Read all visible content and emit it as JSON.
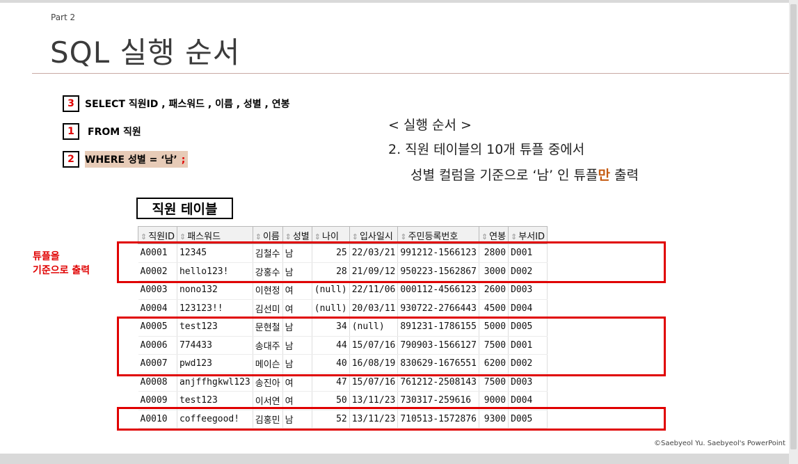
{
  "slide": {
    "part": "Part 2",
    "title": "SQL 실행 순서",
    "copyright": "©Saebyeol Yu. Saebyeol's PowerPoint"
  },
  "query": {
    "select": {
      "num": "3",
      "text": "SELECT 직원ID ,  패스워드 , 이름 , 성별 , 연봉"
    },
    "from": {
      "num": "1",
      "text": "FROM 직원"
    },
    "where": {
      "num": "2",
      "text": "WHERE 성별 = ‘남’",
      "semicolon": ";"
    }
  },
  "explanation": {
    "heading": "< 실행 순서 >",
    "line1": "2. 직원 테이블의 10개 튜플 중에서",
    "line2_prefix": "성별 컬럼을 기준으로 ‘남’ 인 튜플",
    "line2_highlight": "만",
    "line2_suffix": " 출력"
  },
  "side_note": {
    "line1": "튜플을",
    "line2": "기준으로 출력"
  },
  "table": {
    "title": "직원 테이블",
    "headers": [
      "직원ID",
      "패스워드",
      "이름",
      "성별",
      "나이",
      "입사일시",
      "주민등록번호",
      "연봉",
      "부서ID"
    ],
    "rows": [
      [
        "A0001",
        "12345",
        "김철수",
        "남",
        "25",
        "22/03/21",
        "991212-1566123",
        "2800",
        "D001"
      ],
      [
        "A0002",
        "hello123!",
        "강홍수",
        "남",
        "28",
        "21/09/12",
        "950223-1562867",
        "3000",
        "D002"
      ],
      [
        "A0003",
        "nono132",
        "이현정",
        "여",
        "(null)",
        "22/11/06",
        "000112-4566123",
        "2600",
        "D003"
      ],
      [
        "A0004",
        "123123!!",
        "김선미",
        "여",
        "(null)",
        "20/03/11",
        "930722-2766443",
        "4500",
        "D004"
      ],
      [
        "A0005",
        "test123",
        "문현철",
        "남",
        "34",
        "(null)",
        "891231-1786155",
        "5000",
        "D005"
      ],
      [
        "A0006",
        "774433",
        "송대주",
        "남",
        "44",
        "15/07/16",
        "790903-1566127",
        "7500",
        "D001"
      ],
      [
        "A0007",
        "pwd123",
        "메이슨",
        "남",
        "40",
        "16/08/19",
        "830629-1676551",
        "6200",
        "D002"
      ],
      [
        "A0008",
        "anjffhgkwl123",
        "송진아",
        "여",
        "47",
        "15/07/16",
        "761212-2508143",
        "7500",
        "D003"
      ],
      [
        "A0009",
        "test123",
        "이서연",
        "여",
        "50",
        "13/11/23",
        "730317-259616",
        "9000",
        "D004"
      ],
      [
        "A0010",
        "coffeegood!",
        "김홍민",
        "남",
        "52",
        "13/11/23",
        "710513-1572876",
        "9300",
        "D005"
      ]
    ]
  }
}
